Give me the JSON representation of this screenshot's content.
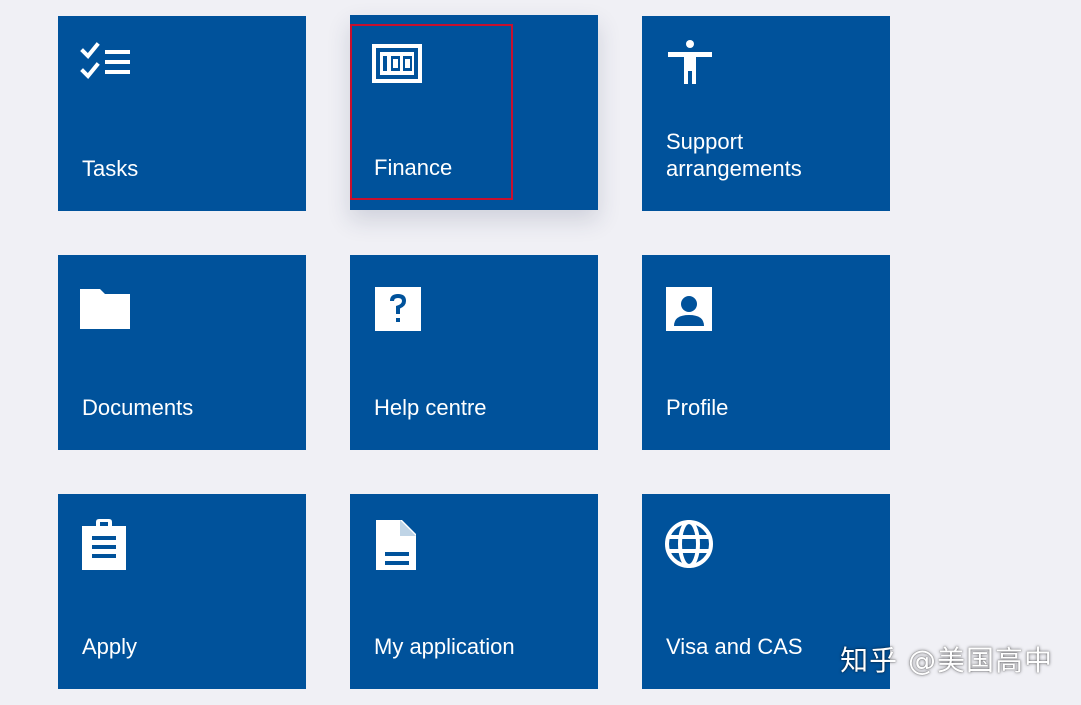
{
  "tiles": [
    {
      "label": "Tasks",
      "icon": "checklist-icon"
    },
    {
      "label": "Finance",
      "icon": "banknote-icon"
    },
    {
      "label": "Support\narrangements",
      "icon": "accessibility-icon"
    },
    {
      "label": "Documents",
      "icon": "folder-icon"
    },
    {
      "label": "Help centre",
      "icon": "help-icon"
    },
    {
      "label": "Profile",
      "icon": "profile-icon"
    },
    {
      "label": "Apply",
      "icon": "clipboard-icon"
    },
    {
      "label": "My application",
      "icon": "document-icon"
    },
    {
      "label": "Visa and CAS",
      "icon": "globe-icon"
    }
  ],
  "watermark": {
    "text": "知乎 @美国高中"
  },
  "colors": {
    "background": "#f0f0f5",
    "tile": "#00529b",
    "tile_text": "#ffffff",
    "highlight": "#c8102e"
  }
}
